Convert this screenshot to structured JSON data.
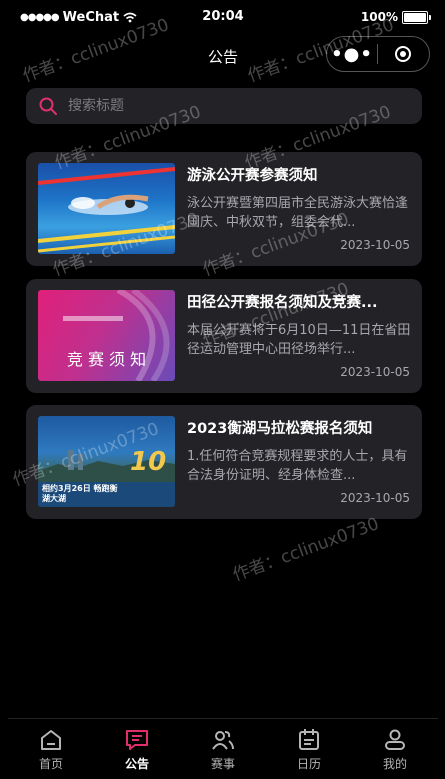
{
  "status_bar": {
    "carrier": "WeChat",
    "time": "20:04",
    "battery": "100%"
  },
  "navbar": {
    "title": "公告"
  },
  "search": {
    "placeholder": "搜索标题"
  },
  "notices": [
    {
      "title": "游泳公开赛参赛须知",
      "desc": "泳公开赛暨第四届市全民游泳大赛恰逢国庆、中秋双节，组委会代...",
      "date": "2023-10-05"
    },
    {
      "title": "田径公开赛报名须知及竞赛...",
      "desc": "本届公开赛将于6月10日—11日在省田径运动管理中心田径场举行...",
      "date": "2023-10-05",
      "thumb_text": "竞 赛 须 知"
    },
    {
      "title": "2023衡湖马拉松赛报名须知",
      "desc": "1.任何符合竞赛规程要求的人士，具有合法身份证明、经身体检查...",
      "date": "2023-10-05",
      "thumb_text": "相约3月26日 畅跑衡湖大湖"
    }
  ],
  "tabbar": [
    {
      "label": "首页",
      "icon": "home-icon"
    },
    {
      "label": "公告",
      "icon": "notice-chat-icon",
      "active": true
    },
    {
      "label": "赛事",
      "icon": "users-icon"
    },
    {
      "label": "日历",
      "icon": "calendar-icon"
    },
    {
      "label": "我的",
      "icon": "profile-icon"
    }
  ],
  "watermark": "作者：cclinux0730",
  "colors": {
    "accent": "#e0306a",
    "background": "#000000",
    "card": "#232226"
  }
}
